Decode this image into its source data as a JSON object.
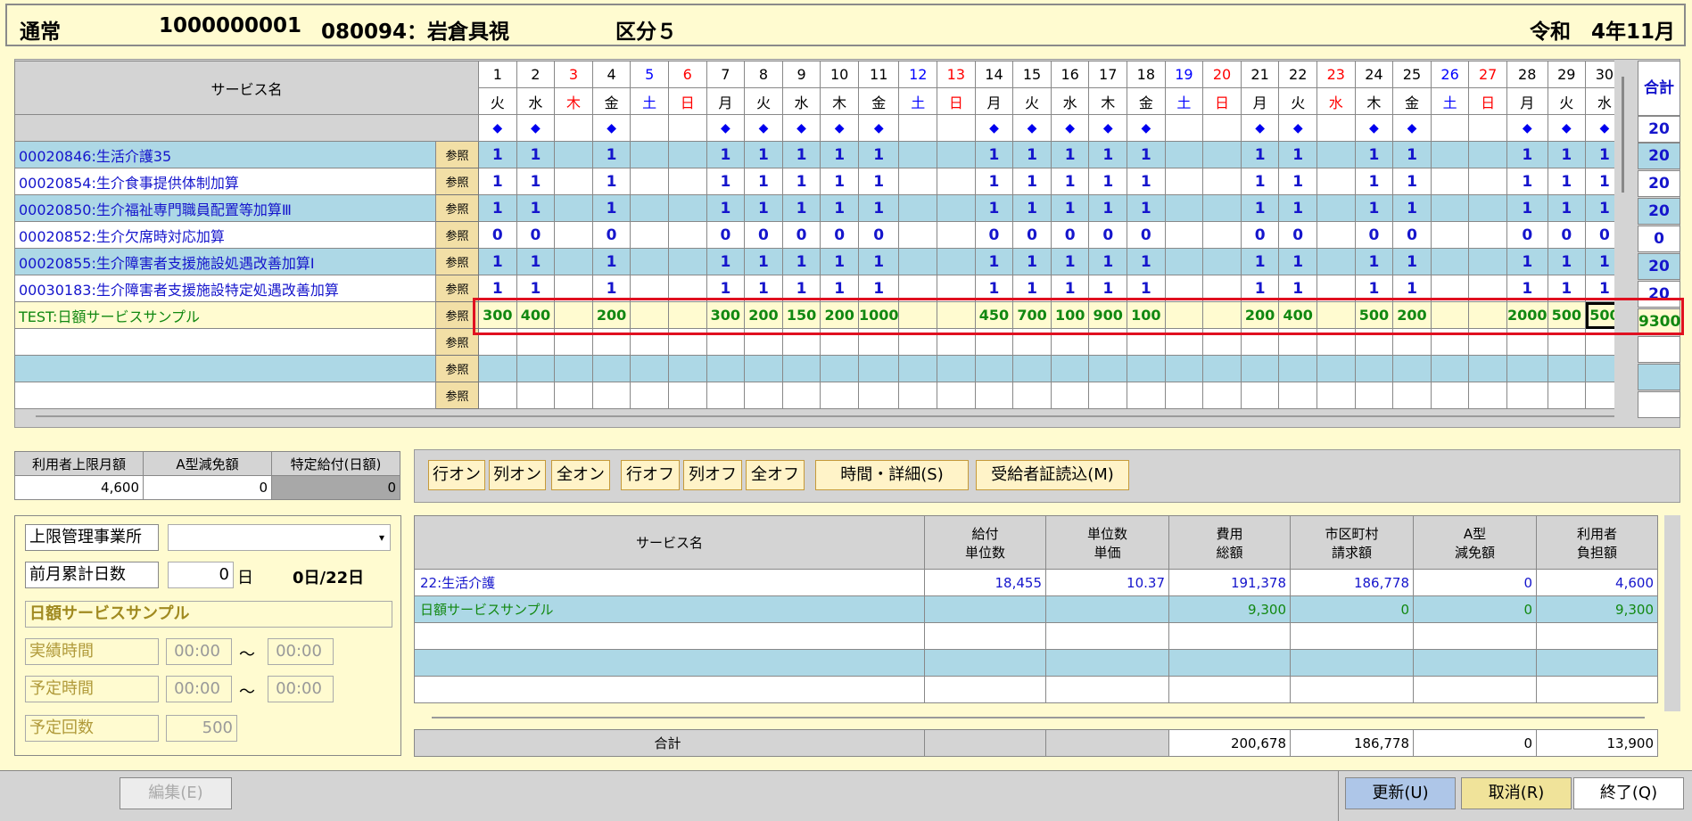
{
  "header": {
    "mode": "通常",
    "user_id": "1000000001",
    "user": "080094：岩倉具視",
    "category": "区分５",
    "period": "令和　4年11月"
  },
  "grid": {
    "service_header": "サービス名",
    "total_header": "合計",
    "ref_label": "参照",
    "days": [
      {
        "d": "1",
        "w": "火",
        "c": "n",
        "m": true
      },
      {
        "d": "2",
        "w": "水",
        "c": "n",
        "m": true
      },
      {
        "d": "3",
        "w": "木",
        "c": "r",
        "m": false
      },
      {
        "d": "4",
        "w": "金",
        "c": "n",
        "m": true
      },
      {
        "d": "5",
        "w": "土",
        "c": "b",
        "m": false
      },
      {
        "d": "6",
        "w": "日",
        "c": "r",
        "m": false
      },
      {
        "d": "7",
        "w": "月",
        "c": "n",
        "m": true
      },
      {
        "d": "8",
        "w": "火",
        "c": "n",
        "m": true
      },
      {
        "d": "9",
        "w": "水",
        "c": "n",
        "m": true
      },
      {
        "d": "10",
        "w": "木",
        "c": "n",
        "m": true
      },
      {
        "d": "11",
        "w": "金",
        "c": "n",
        "m": true
      },
      {
        "d": "12",
        "w": "土",
        "c": "b",
        "m": false
      },
      {
        "d": "13",
        "w": "日",
        "c": "r",
        "m": false
      },
      {
        "d": "14",
        "w": "月",
        "c": "n",
        "m": true
      },
      {
        "d": "15",
        "w": "火",
        "c": "n",
        "m": true
      },
      {
        "d": "16",
        "w": "水",
        "c": "n",
        "m": true
      },
      {
        "d": "17",
        "w": "木",
        "c": "n",
        "m": true
      },
      {
        "d": "18",
        "w": "金",
        "c": "n",
        "m": true
      },
      {
        "d": "19",
        "w": "土",
        "c": "b",
        "m": false
      },
      {
        "d": "20",
        "w": "日",
        "c": "r",
        "m": false
      },
      {
        "d": "21",
        "w": "月",
        "c": "n",
        "m": true
      },
      {
        "d": "22",
        "w": "火",
        "c": "n",
        "m": true
      },
      {
        "d": "23",
        "w": "水",
        "c": "r",
        "m": false
      },
      {
        "d": "24",
        "w": "木",
        "c": "n",
        "m": true
      },
      {
        "d": "25",
        "w": "金",
        "c": "n",
        "m": true
      },
      {
        "d": "26",
        "w": "土",
        "c": "b",
        "m": false
      },
      {
        "d": "27",
        "w": "日",
        "c": "r",
        "m": false
      },
      {
        "d": "28",
        "w": "月",
        "c": "n",
        "m": true
      },
      {
        "d": "29",
        "w": "火",
        "c": "n",
        "m": true
      },
      {
        "d": "30",
        "w": "水",
        "c": "n",
        "m": true
      }
    ],
    "marker": "◆",
    "marker_total": "20",
    "rows": [
      {
        "name": "00020846:生活介護35",
        "v": "1",
        "t": "20",
        "style": "c"
      },
      {
        "name": "00020854:生介食事提供体制加算",
        "v": "1",
        "t": "20",
        "style": "w"
      },
      {
        "name": "00020850:生介福祉専門職員配置等加算Ⅲ",
        "v": "1",
        "t": "20",
        "style": "c"
      },
      {
        "name": "00020852:生介欠席時対応加算",
        "v": "0",
        "t": "0",
        "style": "w"
      },
      {
        "name": "00020855:生介障害者支援施設処遇改善加算Ⅰ",
        "v": "1",
        "t": "20",
        "style": "c"
      },
      {
        "name": "00030183:生介障害者支援施設特定処遇改善加算",
        "v": "1",
        "t": "20",
        "style": "w"
      }
    ],
    "test_row": {
      "name": "TEST:日額サービスサンプル",
      "values": [
        "300",
        "400",
        "",
        "200",
        "",
        "",
        "300",
        "200",
        "150",
        "200",
        "1000",
        "",
        "",
        "450",
        "700",
        "100",
        "900",
        "100",
        "",
        "",
        "200",
        "400",
        "",
        "500",
        "200",
        "",
        "",
        "2000",
        "500",
        "500"
      ],
      "total": "9300"
    }
  },
  "limits": {
    "h1": "利用者上限月額",
    "h2": "A型減免額",
    "h3": "特定給付(日額)",
    "v1": "4,600",
    "v2": "0",
    "v3": "0"
  },
  "buttons": {
    "row_on": "行オン",
    "col_on": "列オン",
    "all_on": "全オン",
    "row_off": "行オフ",
    "col_off": "列オフ",
    "all_off": "全オフ",
    "time_detail": "時間・詳細(S)",
    "cert": "受給者証読込(M)"
  },
  "left": {
    "office_label": "上限管理事業所",
    "office_value": "",
    "prev_days_label": "前月累計日数",
    "prev_days_value": "0",
    "day_unit": "日",
    "day_summary": "0日/22日",
    "service_name": "日額サービスサンプル",
    "actual_time": "実績時間",
    "plan_time": "予定時間",
    "plan_count": "予定回数",
    "t1": "00:00",
    "t2": "00:00",
    "t3": "00:00",
    "t4": "00:00",
    "tilde": "～",
    "count_value": "500"
  },
  "result": {
    "headers": [
      "サービス名",
      "給付\n単位数",
      "単位数\n単価",
      "費用\n総額",
      "市区町村\n請求額",
      "A型\n減免額",
      "利用者\n負担額"
    ],
    "rows": [
      [
        "22:生活介護",
        "18,455",
        "10.37",
        "191,378",
        "186,778",
        "0",
        "4,600"
      ],
      [
        "日額サービスサンプル",
        "",
        "",
        "9,300",
        "0",
        "0",
        "9,300"
      ]
    ],
    "sum_label": "合計",
    "sum": [
      "",
      "",
      "200,678",
      "186,778",
      "0",
      "13,900"
    ]
  },
  "footer": {
    "edit": "編集(E)",
    "update": "更新(U)",
    "cancel": "取消(R)",
    "quit": "終了(Q)"
  }
}
